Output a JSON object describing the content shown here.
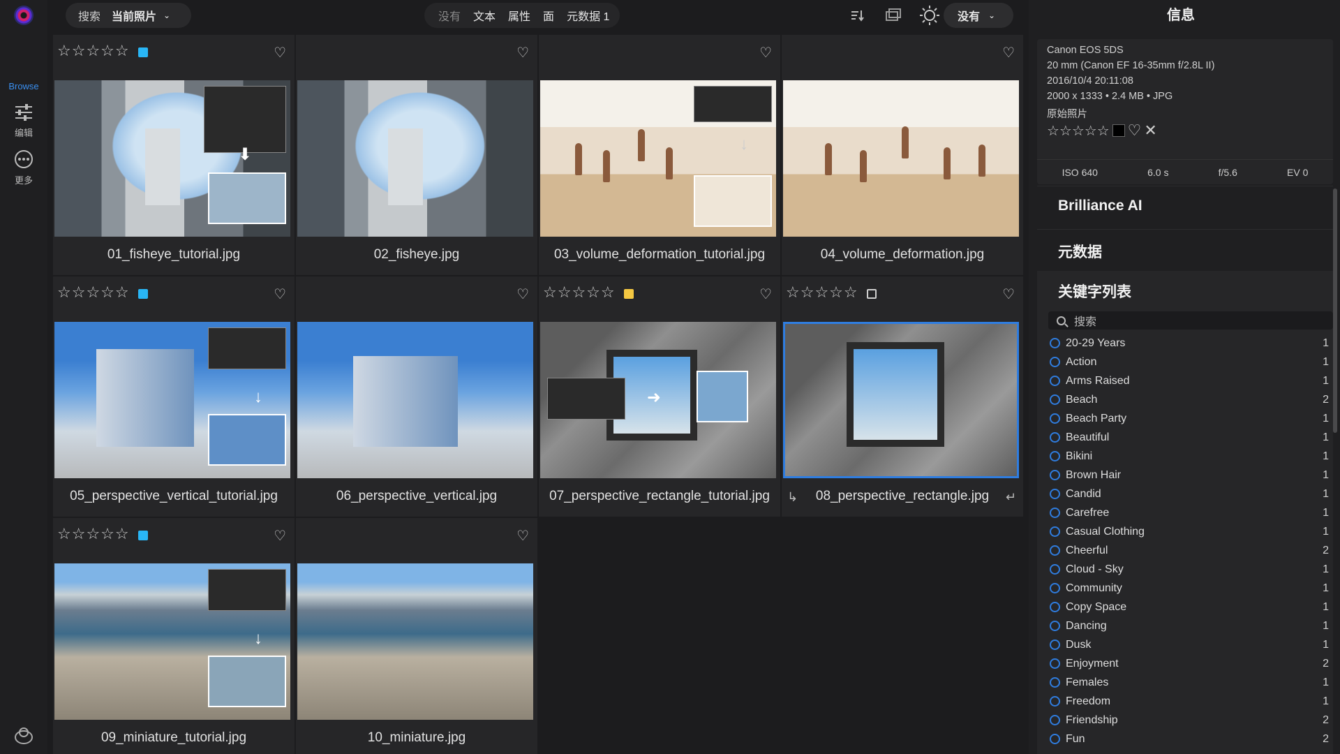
{
  "rail": {
    "browse": "Browse",
    "edit": "编辑",
    "more": "更多"
  },
  "topbar": {
    "search_label": "搜索",
    "search_scope": "当前照片",
    "filters": [
      "没有",
      "文本",
      "属性",
      "面",
      "元数据 1"
    ],
    "sort_menu": "没有"
  },
  "photos": [
    {
      "filename": "01_fisheye_tutorial.jpg",
      "stars": "☆☆☆☆☆",
      "label_color": "#29b6f6",
      "selected": false
    },
    {
      "filename": "02_fisheye.jpg",
      "stars": "",
      "label_color": "",
      "selected": false
    },
    {
      "filename": "03_volume_deformation_tutorial.jpg",
      "stars": "",
      "label_color": "",
      "selected": false
    },
    {
      "filename": "04_volume_deformation.jpg",
      "stars": "",
      "label_color": "",
      "selected": false
    },
    {
      "filename": "05_perspective_vertical_tutorial.jpg",
      "stars": "☆☆☆☆☆",
      "label_color": "#29b6f6",
      "selected": false
    },
    {
      "filename": "06_perspective_vertical.jpg",
      "stars": "",
      "label_color": "",
      "selected": false
    },
    {
      "filename": "07_perspective_rectangle_tutorial.jpg",
      "stars": "☆☆☆☆☆",
      "label_color": "#f5c842",
      "selected": false
    },
    {
      "filename": "08_perspective_rectangle.jpg",
      "stars": "☆☆☆☆☆",
      "label_color": "none",
      "selected": true
    },
    {
      "filename": "09_miniature_tutorial.jpg",
      "stars": "☆☆☆☆☆",
      "label_color": "#29b6f6",
      "selected": false
    },
    {
      "filename": "10_miniature.jpg",
      "stars": "",
      "label_color": "",
      "selected": false
    }
  ],
  "panel": {
    "title": "信息",
    "camera": "Canon EOS 5DS",
    "lens": "20 mm (Canon EF 16-35mm f/2.8L II)",
    "datetime": "2016/10/4  20:11:08",
    "dimensions": "2000 x 1333 • 2.4 MB • JPG",
    "original": "原始照片",
    "info_stars": "☆☆☆☆☆",
    "exif": {
      "iso": "ISO 640",
      "shutter": "6.0 s",
      "aperture": "f/5.6",
      "ev": "EV 0"
    },
    "brilliance": "Brilliance AI",
    "metadata": "元数据",
    "keywords_title": "关键字列表",
    "keyword_search_placeholder": "搜索",
    "keywords": [
      {
        "name": "20-29 Years",
        "count": "1"
      },
      {
        "name": "Action",
        "count": "1"
      },
      {
        "name": "Arms Raised",
        "count": "1"
      },
      {
        "name": "Beach",
        "count": "2"
      },
      {
        "name": "Beach Party",
        "count": "1"
      },
      {
        "name": "Beautiful",
        "count": "1"
      },
      {
        "name": "Bikini",
        "count": "1"
      },
      {
        "name": "Brown Hair",
        "count": "1"
      },
      {
        "name": "Candid",
        "count": "1"
      },
      {
        "name": "Carefree",
        "count": "1"
      },
      {
        "name": "Casual Clothing",
        "count": "1"
      },
      {
        "name": "Cheerful",
        "count": "2"
      },
      {
        "name": "Cloud - Sky",
        "count": "1"
      },
      {
        "name": "Community",
        "count": "1"
      },
      {
        "name": "Copy Space",
        "count": "1"
      },
      {
        "name": "Dancing",
        "count": "1"
      },
      {
        "name": "Dusk",
        "count": "1"
      },
      {
        "name": "Enjoyment",
        "count": "2"
      },
      {
        "name": "Females",
        "count": "1"
      },
      {
        "name": "Freedom",
        "count": "1"
      },
      {
        "name": "Friendship",
        "count": "2"
      },
      {
        "name": "Fun",
        "count": "2"
      }
    ]
  }
}
